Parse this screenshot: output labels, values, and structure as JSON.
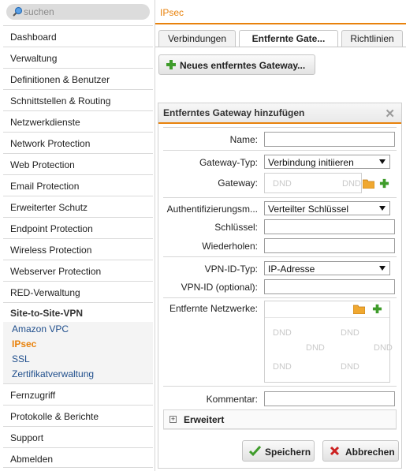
{
  "search": {
    "placeholder": "suchen"
  },
  "sidebar": {
    "items_top": [
      "Dashboard",
      "Verwaltung",
      "Definitionen & Benutzer",
      "Schnittstellen & Routing",
      "Netzwerkdienste",
      "Network Protection",
      "Web Protection",
      "Email Protection",
      "Erweiterter Schutz",
      "Endpoint Protection",
      "Wireless Protection",
      "Webserver Protection",
      "RED-Verwaltung"
    ],
    "group": {
      "title": "Site-to-Site-VPN",
      "subitems": [
        "Amazon VPC",
        "IPsec",
        "SSL",
        "Zertifikatverwaltung"
      ],
      "active": "IPsec"
    },
    "items_bottom": [
      "Fernzugriff",
      "Protokolle & Berichte",
      "Support",
      "Abmelden"
    ]
  },
  "header": {
    "title": "IPsec"
  },
  "tabs": [
    "Verbindungen",
    "Entfernte Gate...",
    "Richtlinien"
  ],
  "active_tab": "Entfernte Gate...",
  "new_gateway_button": "Neues entferntes Gateway...",
  "dialog": {
    "title": "Entferntes Gateway hinzufügen",
    "labels": {
      "name": "Name:",
      "gateway_type": "Gateway-Typ:",
      "gateway": "Gateway:",
      "auth": "Authentifizierungsm...",
      "key": "Schlüssel:",
      "repeat": "Wiederholen:",
      "vpn_id_type": "VPN-ID-Typ:",
      "vpn_id": "VPN-ID (optional):",
      "remote_networks": "Entfernte Netzwerke:",
      "comment": "Kommentar:"
    },
    "values": {
      "name": "",
      "gateway_type": "Verbindung initiieren",
      "auth": "Verteilter Schlüssel",
      "key": "",
      "repeat": "",
      "vpn_id_type": "IP-Adresse",
      "vpn_id": "",
      "comment": ""
    },
    "dnd": "DND",
    "advanced": "Erweitert",
    "save": "Speichern",
    "cancel": "Abbrechen"
  },
  "colors": {
    "accent": "#e8820c",
    "link": "#1f4e8c",
    "plus_green": "#3f9c2b",
    "cancel_red": "#cc2222"
  },
  "icons": [
    "search-icon",
    "plus-icon",
    "close-icon",
    "folder-icon",
    "check-icon",
    "x-icon",
    "expand-icon"
  ]
}
